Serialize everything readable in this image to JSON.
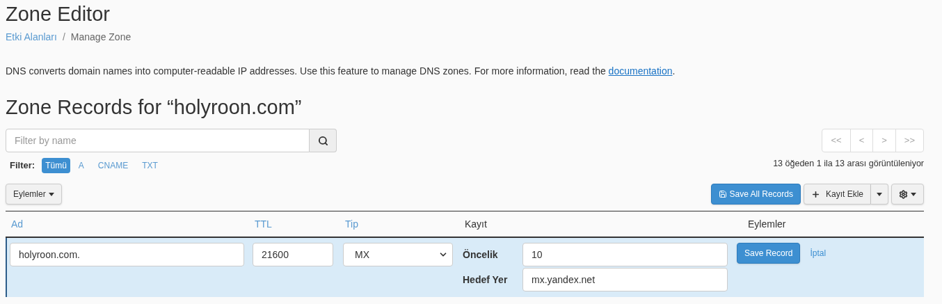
{
  "page_title": "Zone Editor",
  "breadcrumb": {
    "separator": "/",
    "items": [
      {
        "label": "Etki Alanları",
        "link": true
      },
      {
        "label": "Manage Zone",
        "link": false
      }
    ]
  },
  "description": {
    "text": "DNS converts domain names into computer-readable IP addresses. Use this feature to manage DNS zones. For more information, read the",
    "link": "documentation",
    "after": "."
  },
  "zone_heading": "Zone Records for “holyroon.com”",
  "search": {
    "placeholder": "Filter by name"
  },
  "filter": {
    "label": "Filter:",
    "options": [
      {
        "label": "Tümü",
        "selected": true
      },
      {
        "label": "A",
        "selected": false
      },
      {
        "label": "CNAME",
        "selected": false
      },
      {
        "label": "TXT",
        "selected": false
      }
    ]
  },
  "pagination": [
    "<<",
    "<",
    ">",
    ">>"
  ],
  "pagination_info": "13 öğeden 1 ila 13 arası görüntüleniyor",
  "actions_menu": "Eylemler",
  "save_all": "Save All Records",
  "add_record": "Kayıt Ekle",
  "columns": [
    {
      "label": "Ad",
      "sortable": true
    },
    {
      "label": "TTL",
      "sortable": true
    },
    {
      "label": "Tip",
      "sortable": true
    },
    {
      "label": "Kayıt",
      "sortable": false
    },
    {
      "label": "Eylemler",
      "sortable": false
    }
  ],
  "edit_row": {
    "name": "holyroon.com.",
    "ttl": "21600",
    "type": "MX",
    "fields": [
      {
        "label": "Öncelik",
        "value": "10"
      },
      {
        "label": "Hedef Yer",
        "value": "mx.yandex.net"
      }
    ],
    "save": "Save Record",
    "cancel": "İptal"
  }
}
